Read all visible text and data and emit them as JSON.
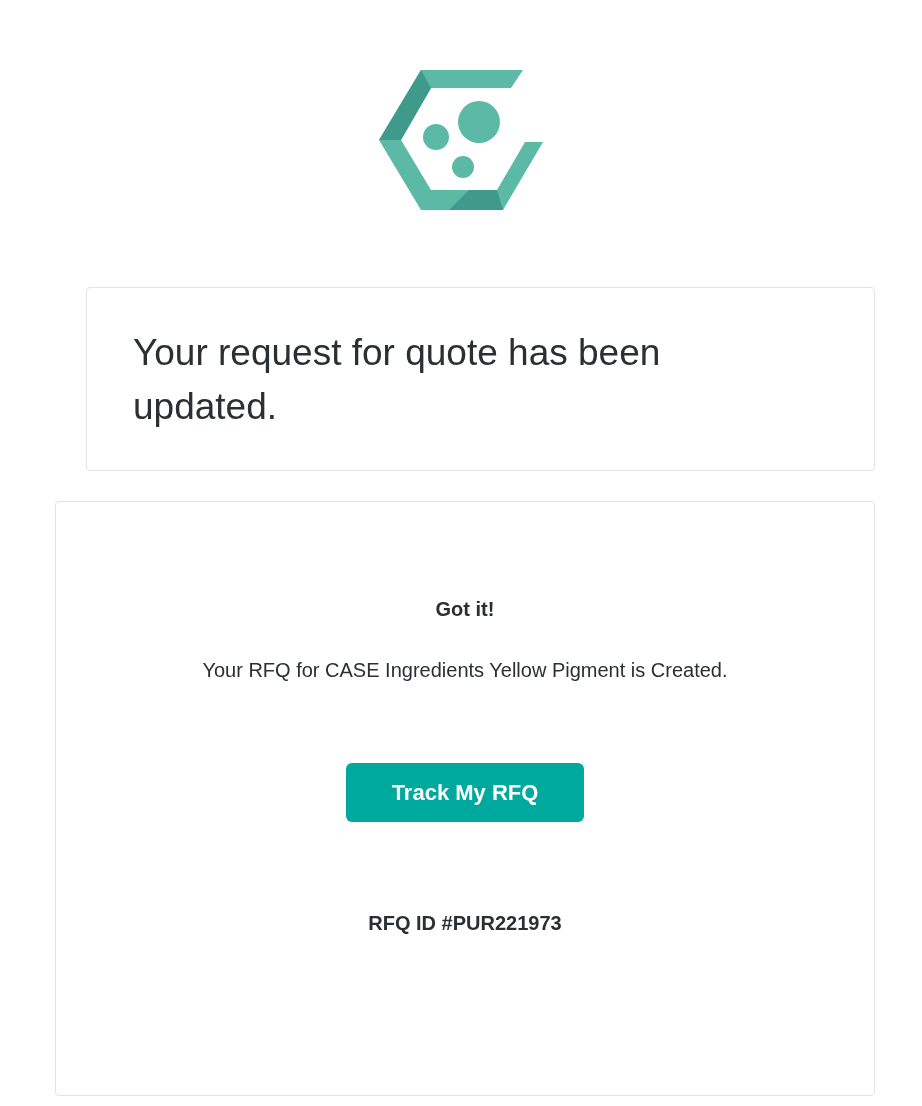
{
  "header": {
    "title": "Your request for quote has been updated."
  },
  "confirmation": {
    "heading": "Got it!",
    "message": "Your RFQ for CASE Ingredients Yellow Pigment is Created.",
    "button": "Track My RFQ",
    "rfq_id": "RFQ ID #PUR221973"
  }
}
